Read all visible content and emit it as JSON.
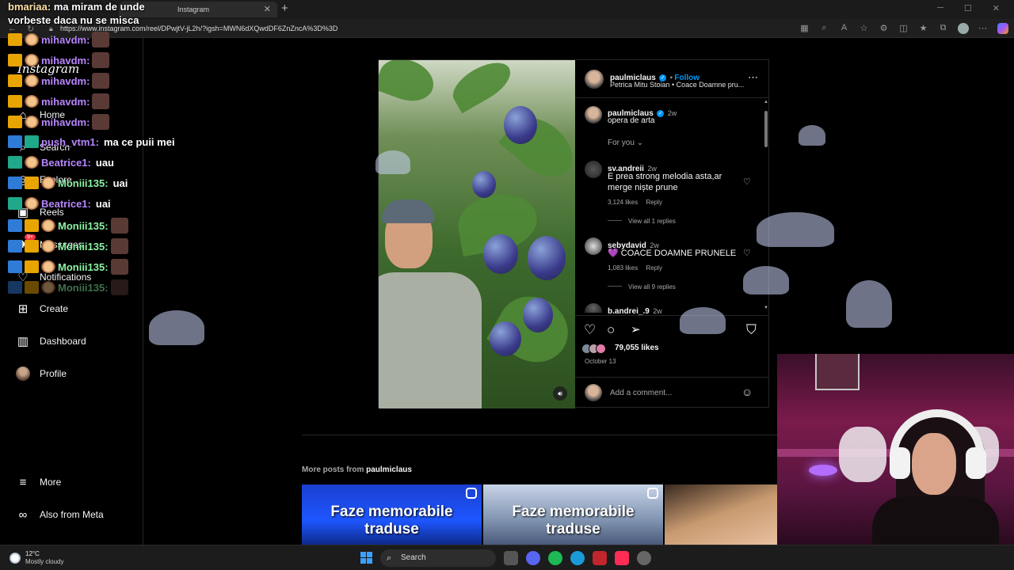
{
  "browser": {
    "tab_title": "Instagram",
    "url": "https://www.instagram.com/reel/DPwjtV-jL2h/?igsh=MWN6dXQwdDF6ZnZncA%3D%3D"
  },
  "sidebar": {
    "logo": "Instagram",
    "items": [
      {
        "label": "Home",
        "icon": "home-icon",
        "glyph": "⌂"
      },
      {
        "label": "Search",
        "icon": "search-icon",
        "glyph": "⌕"
      },
      {
        "label": "Explore",
        "icon": "compass-icon",
        "glyph": "◎"
      },
      {
        "label": "Reels",
        "icon": "reels-icon",
        "glyph": "▣"
      },
      {
        "label": "Messages",
        "icon": "messages-icon",
        "glyph": "✈"
      },
      {
        "label": "Notifications",
        "icon": "heart-icon",
        "glyph": "♡"
      },
      {
        "label": "Create",
        "icon": "plus-square-icon",
        "glyph": "⊞"
      },
      {
        "label": "Dashboard",
        "icon": "dashboard-icon",
        "glyph": "▥"
      },
      {
        "label": "Profile",
        "icon": "avatar-icon",
        "glyph": ""
      },
      {
        "label": "More",
        "icon": "menu-icon",
        "glyph": "≡"
      },
      {
        "label": "Also from Meta",
        "icon": "threads-icon",
        "glyph": "∞"
      }
    ],
    "messages_badge": "9+"
  },
  "chat": {
    "top_user": "bmariaa:",
    "top_text_1": "ma miram de unde",
    "top_text_2": "vorbeste daca nu se misca",
    "messages": [
      {
        "user": "mihavdm:",
        "text": "",
        "color": "purple"
      },
      {
        "user": "mihavdm:",
        "text": "",
        "color": "purple"
      },
      {
        "user": "mihavdm:",
        "text": "",
        "color": "purple"
      },
      {
        "user": "mihavdm:",
        "text": "",
        "color": "purple"
      },
      {
        "user": "mihavdm:",
        "text": "",
        "color": "purple"
      },
      {
        "user": "push_vtm1:",
        "text": "ma ce puii mei",
        "color": "purple"
      },
      {
        "user": "Beatrice1:",
        "text": "uau",
        "color": "purple"
      },
      {
        "user": "Moniii135:",
        "text": "uai",
        "color": "green"
      },
      {
        "user": "Beatrice1:",
        "text": "uai",
        "color": "purple"
      },
      {
        "user": "Moniii135:",
        "text": "",
        "color": "green"
      },
      {
        "user": "Moniii135:",
        "text": "",
        "color": "green"
      },
      {
        "user": "Moniii135:",
        "text": "",
        "color": "green"
      },
      {
        "user": "Moniii135:",
        "text": "",
        "color": "green"
      }
    ]
  },
  "post": {
    "author": "paulmiclaus",
    "follow": "Follow",
    "audio": "Petrica Mitu Stoian • Coace Doamne pru...",
    "caption": "opera de arta",
    "caption_age": "2w",
    "sort": "For you",
    "comments": [
      {
        "user": "sv.andreii",
        "age": "2w",
        "text1": "E prea strong melodia asta,ar",
        "text2": "merge niște prune",
        "likes": "3,124 likes",
        "reply": "Reply",
        "view": "View all 1 replies"
      },
      {
        "user": "sebydavid",
        "age": "2w",
        "text1": "💜 COACE DOAMNE PRUNELE",
        "text2": "",
        "likes": "1,083 likes",
        "reply": "Reply",
        "view": "View all 9 replies"
      },
      {
        "user": "b.andrei_.9",
        "age": "2w",
        "text1": "",
        "text2": "",
        "likes": "",
        "reply": "",
        "view": ""
      }
    ],
    "like_count": "79,055 likes",
    "date": "October 13",
    "add_comment_placeholder": "Add a comment..."
  },
  "more_posts": {
    "prefix": "More posts from",
    "author": "paulmiclaus",
    "thumbs": [
      {
        "caption": "Faze memorabile traduse"
      },
      {
        "caption": "Faze memorabile traduse"
      },
      {
        "caption": ""
      }
    ]
  },
  "taskbar": {
    "temperature": "12°C",
    "condition": "Mostly cloudy",
    "search": "Search"
  },
  "colors": {
    "ig_blue": "#0095f6",
    "chat_purple": "#b886ff",
    "chat_green": "#8df3a4"
  }
}
